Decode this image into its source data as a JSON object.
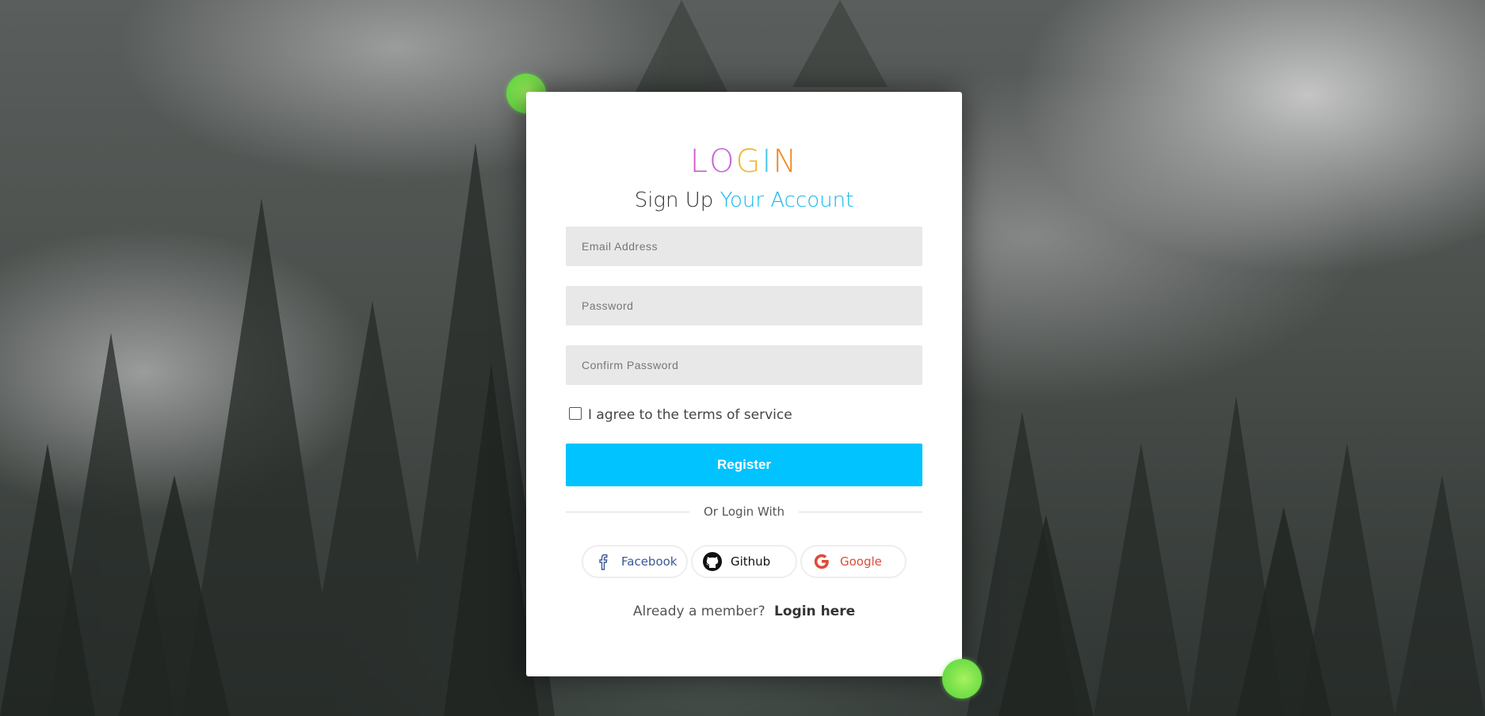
{
  "logo": {
    "letters": [
      "L",
      "O",
      "G",
      "I",
      "N"
    ]
  },
  "heading": {
    "part1": "Sign Up",
    "part2": "Your Account"
  },
  "form": {
    "email_placeholder": "Email Address",
    "password_placeholder": "Password",
    "confirm_placeholder": "Confirm Password",
    "terms_label": "I agree to the terms of service",
    "terms_checked": false,
    "register_label": "Register"
  },
  "divider_text": "Or Login With",
  "socials": [
    {
      "label": "Facebook",
      "icon": "facebook-icon",
      "color": "#3b5998"
    },
    {
      "label": "Github",
      "icon": "github-icon",
      "color": "#111111"
    },
    {
      "label": "Google",
      "icon": "google-icon",
      "color": "#dd4b39"
    }
  ],
  "footer": {
    "prompt": "Already a member?",
    "link": "Login here"
  },
  "colors": {
    "accent": "#00c3ff",
    "dot": "#7ee34d"
  }
}
